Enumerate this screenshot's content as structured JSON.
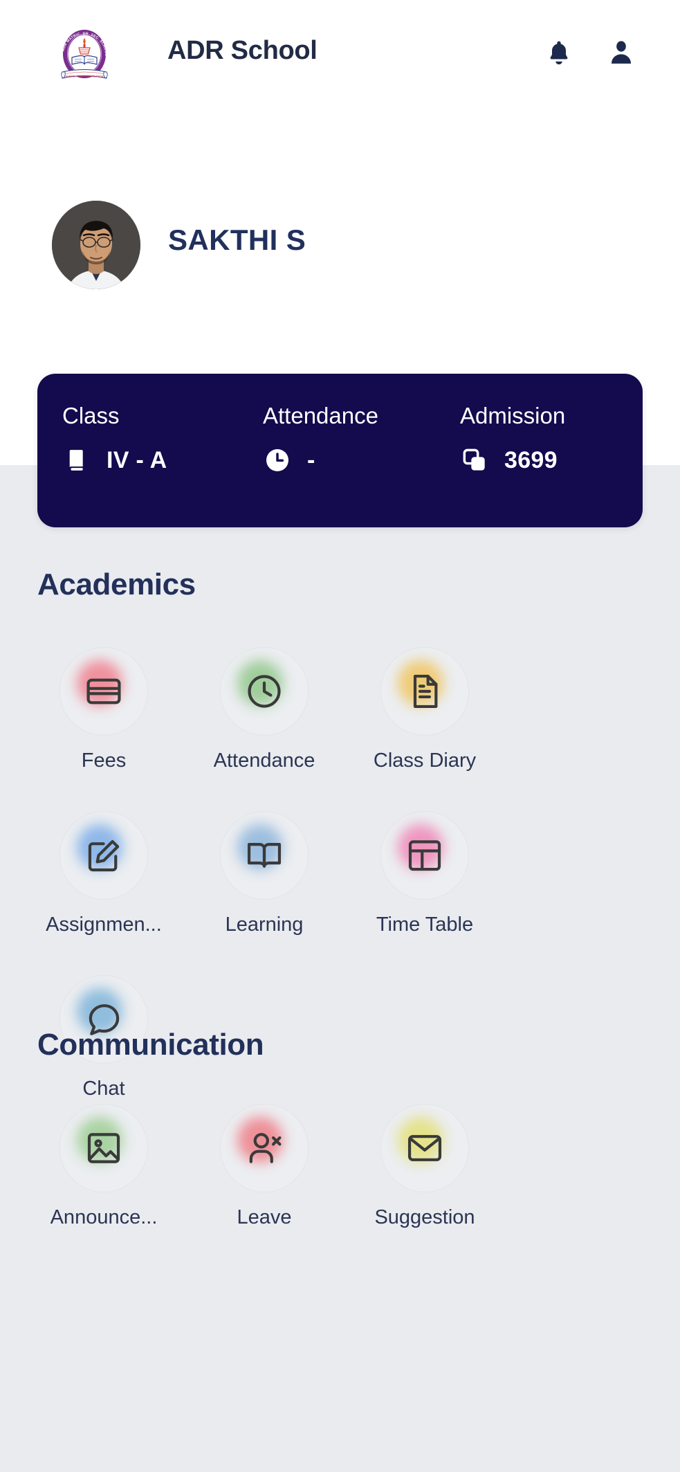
{
  "header": {
    "app_title": "ADR School",
    "logo": {
      "name": "adr-school-logo",
      "ring_text_top": "ADR MATRIC. HR. SEC. SCHOOL",
      "ring_text_bottom": "KAKKURICHI",
      "banner_text": "ASPIRE • EDUCATE • REJOICE",
      "ring_color": "#7b2d8e",
      "accent_color": "#d8413f"
    },
    "notification_icon": "bell-icon",
    "profile_icon": "person-icon"
  },
  "profile": {
    "student_name": "SAKTHI S",
    "avatar_alt": "student-photo"
  },
  "info_card": {
    "background": "#130b4d",
    "items": [
      {
        "label": "Class",
        "value": "IV - A",
        "icon": "book-icon"
      },
      {
        "label": "Attendance",
        "value": "-",
        "icon": "clock-icon"
      },
      {
        "label": "Admission",
        "value": "3699",
        "icon": "copy-icon"
      }
    ]
  },
  "sections": [
    {
      "title": "Academics",
      "tiles": [
        {
          "label": "Fees",
          "icon": "credit-card-icon",
          "blob": "#f0808f"
        },
        {
          "label": "Attendance",
          "icon": "clock-icon",
          "blob": "#93c88c"
        },
        {
          "label": "Class Diary",
          "icon": "document-icon",
          "blob": "#f0c560"
        },
        {
          "label": "Assignmen...",
          "icon": "edit-square-icon",
          "blob": "#7eaee8"
        },
        {
          "label": "Learning",
          "icon": "open-book-icon",
          "blob": "#8fb6dc"
        },
        {
          "label": "Time Table",
          "icon": "table-grid-icon",
          "blob": "#ef87b7"
        },
        {
          "label": "Chat",
          "icon": "chat-bubble-icon",
          "blob": "#7fb4da"
        }
      ]
    },
    {
      "title": "Communication",
      "tiles": [
        {
          "label": "Announce...",
          "icon": "image-icon",
          "blob": "#9ece94"
        },
        {
          "label": "Leave",
          "icon": "person-x-icon",
          "blob": "#ef7f88"
        },
        {
          "label": "Suggestion",
          "icon": "envelope-icon",
          "blob": "#e3e07a"
        }
      ]
    }
  ],
  "theme": {
    "page_background": "#e9ebef",
    "card_background": "#130b4d",
    "heading_color": "#22305a",
    "tile_circle_background": "#eceef1"
  }
}
